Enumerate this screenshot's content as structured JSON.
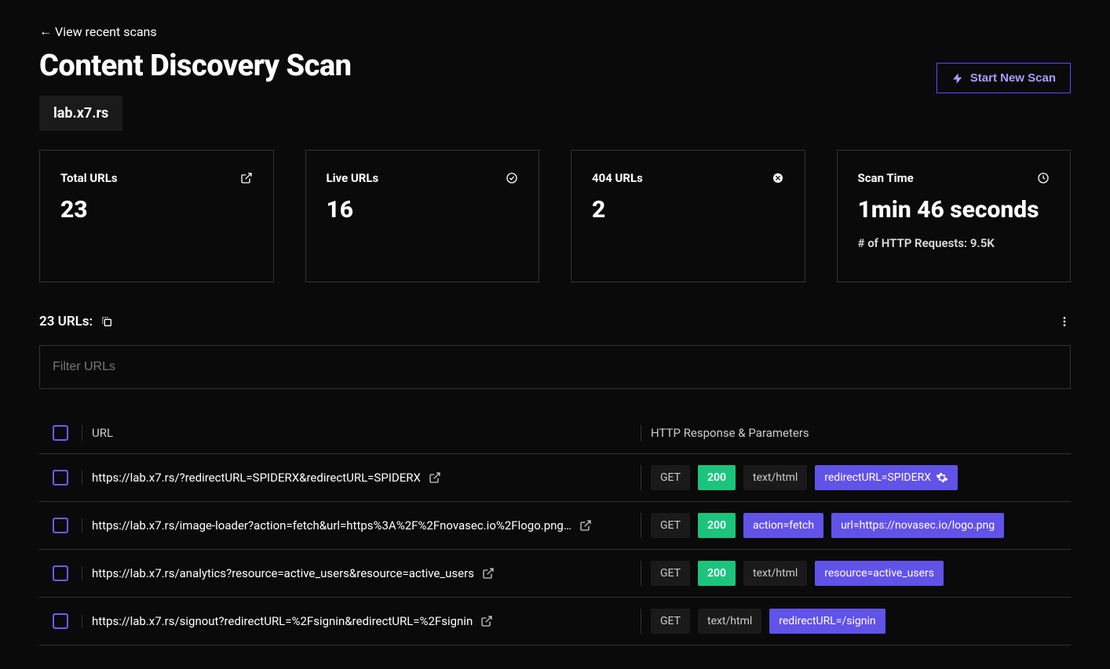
{
  "nav": {
    "back": "View recent scans"
  },
  "header": {
    "title": "Content Discovery Scan",
    "host": "lab.x7.rs",
    "start_scan": "Start New Scan"
  },
  "stats": {
    "total": {
      "label": "Total URLs",
      "value": "23"
    },
    "live": {
      "label": "Live URLs",
      "value": "16"
    },
    "not_found": {
      "label": "404 URLs",
      "value": "2"
    },
    "time": {
      "label": "Scan Time",
      "value": "1min 46 seconds",
      "sub": "# of HTTP Requests: 9.5K"
    }
  },
  "urls_header": "23 URLs:",
  "filter_placeholder": "Filter URLs",
  "columns": {
    "url": "URL",
    "resp": "HTTP Response & Parameters"
  },
  "rows": [
    {
      "url": "https://lab.x7.rs/?redirectURL=SPIDERX&redirectURL=SPIDERX",
      "method": "GET",
      "status": "200",
      "content": "text/html",
      "params": [
        {
          "text": "redirectURL=SPIDERX",
          "gear": true
        }
      ]
    },
    {
      "url": "https://lab.x7.rs/image-loader?action=fetch&url=https%3A%2F%2Fnovasec.io%2Flogo.png…",
      "method": "GET",
      "status": "200",
      "content": "",
      "params": [
        {
          "text": "action=fetch"
        },
        {
          "text": "url=https://novasec.io/logo.png"
        }
      ]
    },
    {
      "url": "https://lab.x7.rs/analytics?resource=active_users&resource=active_users",
      "method": "GET",
      "status": "200",
      "content": "text/html",
      "params": [
        {
          "text": "resource=active_users"
        }
      ]
    },
    {
      "url": "https://lab.x7.rs/signout?redirectURL=%2Fsignin&redirectURL=%2Fsignin",
      "method": "GET",
      "status": "",
      "content": "text/html",
      "params": [
        {
          "text": "redirectURL=/signin"
        }
      ]
    }
  ]
}
